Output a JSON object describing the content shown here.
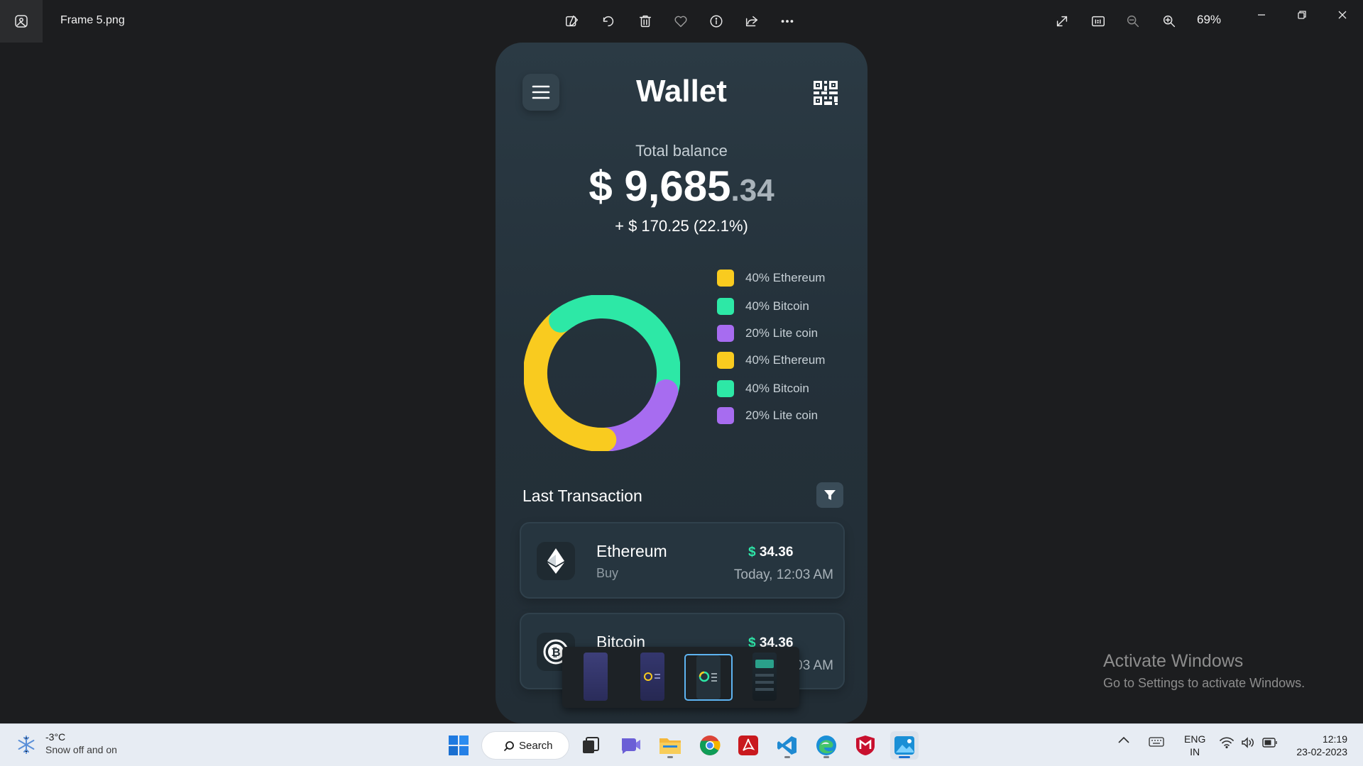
{
  "titlebar": {
    "file_name": "Frame 5.png",
    "zoom": "69%",
    "toolbar_icons": [
      "edit-icon",
      "rotate-icon",
      "delete-icon",
      "favorite-icon",
      "info-icon",
      "share-icon",
      "more-icon"
    ],
    "view_icons": [
      "fullscreen-icon",
      "actual-size-icon",
      "zoom-out-icon",
      "zoom-in-icon"
    ]
  },
  "wallet": {
    "title": "Wallet",
    "total_label": "Total balance",
    "balance_main": "$ 9,685",
    "balance_cents": ".34",
    "change": "+ $ 170.25 (22.1%)",
    "legend": [
      {
        "label": "40% Ethereum",
        "color": "#f9cb1f"
      },
      {
        "label": "40% Bitcoin",
        "color": "#2de8a6"
      },
      {
        "label": "20% Lite coin",
        "color": "#a76cf0"
      },
      {
        "label": "40% Ethereum",
        "color": "#f9cb1f"
      },
      {
        "label": "40% Bitcoin",
        "color": "#2de8a6"
      },
      {
        "label": "20% Lite coin",
        "color": "#a76cf0"
      }
    ],
    "last_transaction_title": "Last Transaction",
    "transactions": [
      {
        "name": "Ethereum",
        "type": "Buy",
        "amount": "34.36",
        "currency": "$",
        "time": "Today, 12:03 AM",
        "icon": "ethereum-icon"
      },
      {
        "name": "Bitcoin",
        "type": "",
        "amount": "34.36",
        "currency": "$",
        "time": "03 AM",
        "icon": "bitcoin-icon"
      }
    ]
  },
  "chart_data": {
    "type": "pie",
    "title": "",
    "categories": [
      "Ethereum",
      "Bitcoin",
      "Lite coin"
    ],
    "values": [
      40,
      40,
      20
    ],
    "colors": [
      "#f9cb1f",
      "#2de8a6",
      "#a76cf0"
    ],
    "style": "donut",
    "legend_position": "right"
  },
  "filmstrip": {
    "count": 4,
    "selected_index": 2
  },
  "watermark": {
    "title": "Activate Windows",
    "subtitle": "Go to Settings to activate Windows."
  },
  "taskbar": {
    "weather_temp": "-3°C",
    "weather_desc": "Snow off and on",
    "search_label": "Search",
    "lang_line1": "ENG",
    "lang_line2": "IN",
    "time": "12:19",
    "date": "23-02-2023",
    "apps": [
      "start-icon",
      "search-icon",
      "task-view-icon",
      "meet-icon",
      "file-explorer-icon",
      "chrome-icon",
      "acrobat-icon",
      "vscode-icon",
      "edge-icon",
      "mcafee-icon",
      "photos-icon"
    ]
  }
}
